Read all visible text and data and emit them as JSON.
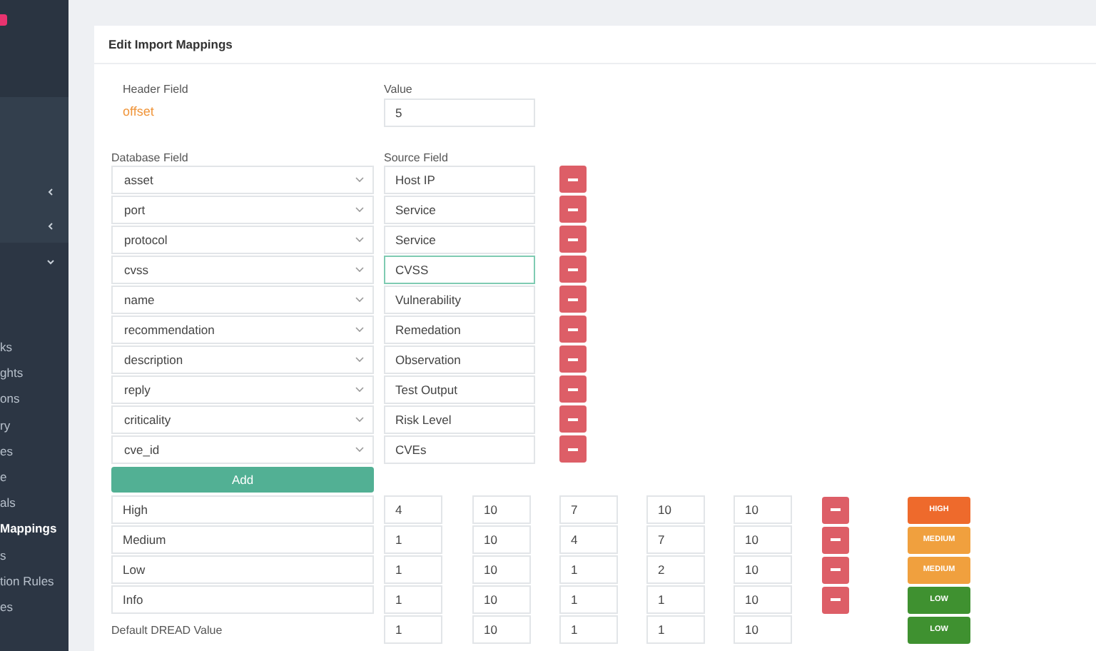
{
  "sidebar": {
    "groups": [
      {
        "expanded": false
      },
      {
        "expanded": false
      },
      {
        "expanded": true
      }
    ],
    "items": [
      {
        "label": "ks",
        "selected": false
      },
      {
        "label": "ghts",
        "selected": false
      },
      {
        "label": "ons",
        "selected": false
      },
      {
        "label": "ry",
        "selected": false
      },
      {
        "label": "es",
        "selected": false
      },
      {
        "label": "e",
        "selected": false
      },
      {
        "label": "als",
        "selected": false
      },
      {
        "label": "Mappings",
        "selected": true
      },
      {
        "label": "s",
        "selected": false
      },
      {
        "label": "tion Rules",
        "selected": false
      },
      {
        "label": "es",
        "selected": false
      }
    ]
  },
  "card": {
    "title": "Edit Import Mappings",
    "header_columns": [
      "Header Field",
      "Value"
    ],
    "header_field": {
      "name": "offset",
      "value": "5"
    },
    "mapping_columns": [
      "Database Field",
      "Source Field"
    ],
    "mappings": [
      {
        "database_field": "asset",
        "source_field": "Host IP",
        "focused": false
      },
      {
        "database_field": "port",
        "source_field": "Service",
        "focused": false
      },
      {
        "database_field": "protocol",
        "source_field": "Service",
        "focused": false
      },
      {
        "database_field": "cvss",
        "source_field": "CVSS",
        "focused": true
      },
      {
        "database_field": "name",
        "source_field": "Vulnerability",
        "focused": false
      },
      {
        "database_field": "recommendation",
        "source_field": "Remedation",
        "focused": false
      },
      {
        "database_field": "description",
        "source_field": "Observation",
        "focused": false
      },
      {
        "database_field": "reply",
        "source_field": "Test Output",
        "focused": false
      },
      {
        "database_field": "criticality",
        "source_field": "Risk Level",
        "focused": false
      },
      {
        "database_field": "cve_id",
        "source_field": "CVEs",
        "focused": false
      }
    ],
    "add_button": "Add",
    "dread_rows": [
      {
        "kind": "editable",
        "name": "High",
        "values": [
          "4",
          "10",
          "7",
          "10",
          "10"
        ],
        "badge": "HIGH",
        "color": "#ee6a2c"
      },
      {
        "kind": "editable",
        "name": "Medium",
        "values": [
          "1",
          "10",
          "4",
          "7",
          "10"
        ],
        "badge": "MEDIUM",
        "color": "#f0a03e"
      },
      {
        "kind": "editable",
        "name": "Low",
        "values": [
          "1",
          "10",
          "1",
          "2",
          "10"
        ],
        "badge": "MEDIUM",
        "color": "#f0a03e"
      },
      {
        "kind": "editable",
        "name": "Info",
        "values": [
          "1",
          "10",
          "1",
          "1",
          "10"
        ],
        "badge": "LOW",
        "color": "#3f9130"
      },
      {
        "kind": "default",
        "name": "Default DREAD Value",
        "values": [
          "1",
          "10",
          "1",
          "1",
          "10"
        ],
        "badge": "LOW",
        "color": "#3f9130"
      }
    ]
  }
}
